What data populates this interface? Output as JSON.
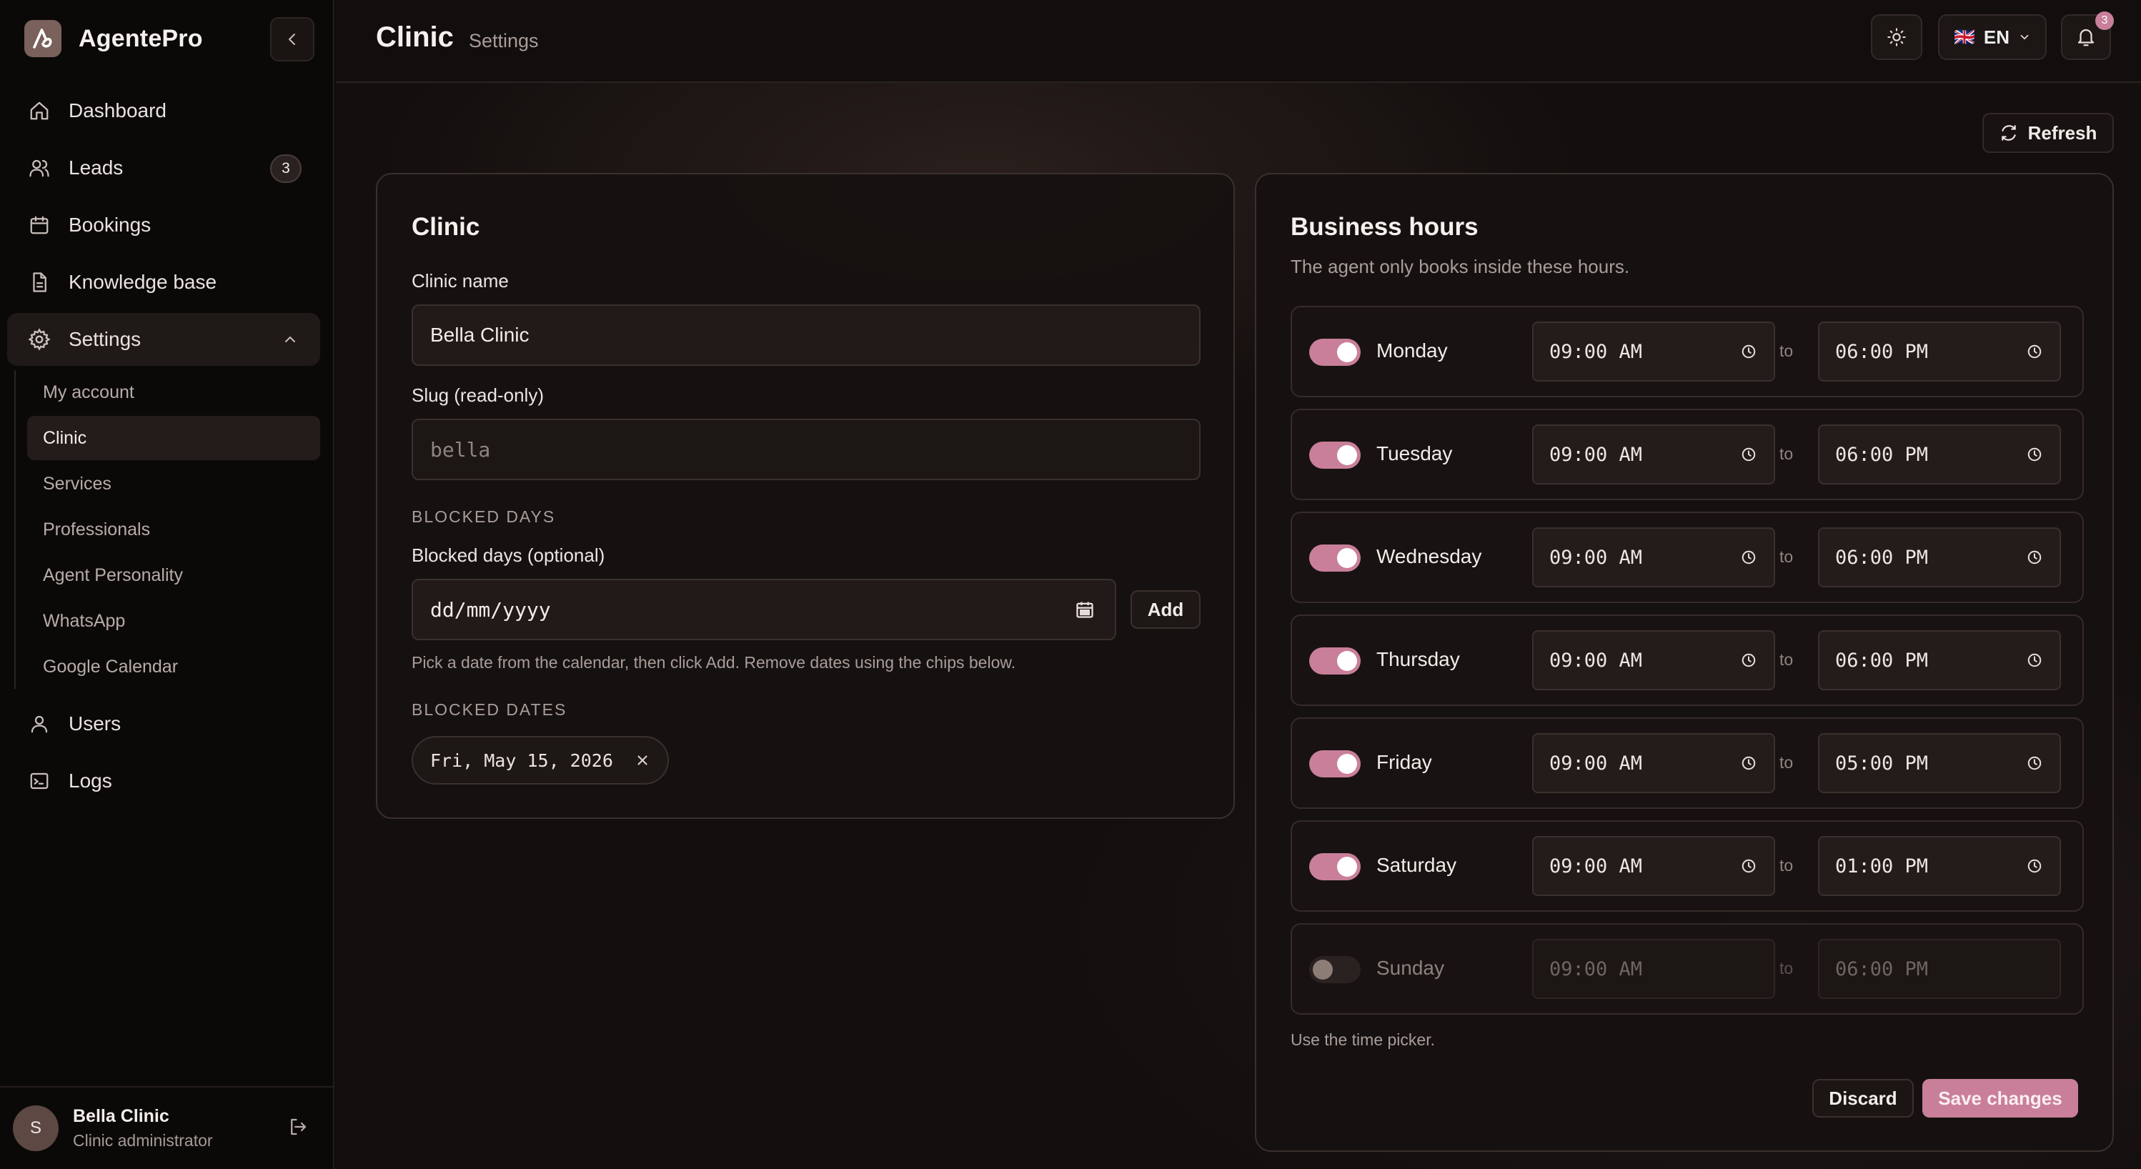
{
  "app": {
    "name": "AgentePro"
  },
  "sidebar": {
    "items": [
      {
        "label": "Dashboard",
        "icon": "home-icon"
      },
      {
        "label": "Leads",
        "icon": "users-icon",
        "badge": "3"
      },
      {
        "label": "Bookings",
        "icon": "calendar-icon"
      },
      {
        "label": "Knowledge base",
        "icon": "document-icon"
      },
      {
        "label": "Settings",
        "icon": "gear-icon"
      }
    ],
    "settings_sub": [
      "My account",
      "Clinic",
      "Services",
      "Professionals",
      "Agent Personality",
      "WhatsApp",
      "Google Calendar"
    ],
    "after": [
      {
        "label": "Users",
        "icon": "user-icon"
      },
      {
        "label": "Logs",
        "icon": "terminal-icon"
      }
    ],
    "user": {
      "initial": "S",
      "name": "Bella Clinic",
      "role": "Clinic administrator"
    }
  },
  "header": {
    "title": "Clinic",
    "subtitle": "Settings",
    "language": "EN",
    "flag": "🇬🇧",
    "notifications_count": "3"
  },
  "actions": {
    "refresh": "Refresh"
  },
  "clinic_card": {
    "title": "Clinic",
    "name_label": "Clinic name",
    "name_value": "Bella Clinic",
    "slug_label": "Slug (read-only)",
    "slug_value": "bella",
    "blocked_days_section": "BLOCKED DAYS",
    "blocked_days_label": "Blocked days (optional)",
    "date_placeholder": "dd/mm/yyyy",
    "add_label": "Add",
    "hint": "Pick a date from the calendar, then click Add. Remove dates using the chips below.",
    "blocked_dates_section": "BLOCKED DATES",
    "blocked_dates": [
      "Fri, May 15, 2026"
    ]
  },
  "hours_card": {
    "title": "Business hours",
    "subtitle": "The agent only books inside these hours.",
    "to_label": "to",
    "days": [
      {
        "name": "Monday",
        "enabled": true,
        "open": "09:00 AM",
        "close": "06:00 PM"
      },
      {
        "name": "Tuesday",
        "enabled": true,
        "open": "09:00 AM",
        "close": "06:00 PM"
      },
      {
        "name": "Wednesday",
        "enabled": true,
        "open": "09:00 AM",
        "close": "06:00 PM"
      },
      {
        "name": "Thursday",
        "enabled": true,
        "open": "09:00 AM",
        "close": "06:00 PM"
      },
      {
        "name": "Friday",
        "enabled": true,
        "open": "09:00 AM",
        "close": "05:00 PM"
      },
      {
        "name": "Saturday",
        "enabled": true,
        "open": "09:00 AM",
        "close": "01:00 PM"
      },
      {
        "name": "Sunday",
        "enabled": false,
        "open": "09:00 AM",
        "close": "06:00 PM"
      }
    ],
    "footnote": "Use the time picker.",
    "discard_label": "Discard",
    "save_label": "Save changes"
  },
  "colors": {
    "accent": "#c97f9a",
    "background": "#130f0e",
    "sidebar": "#0b0908"
  }
}
